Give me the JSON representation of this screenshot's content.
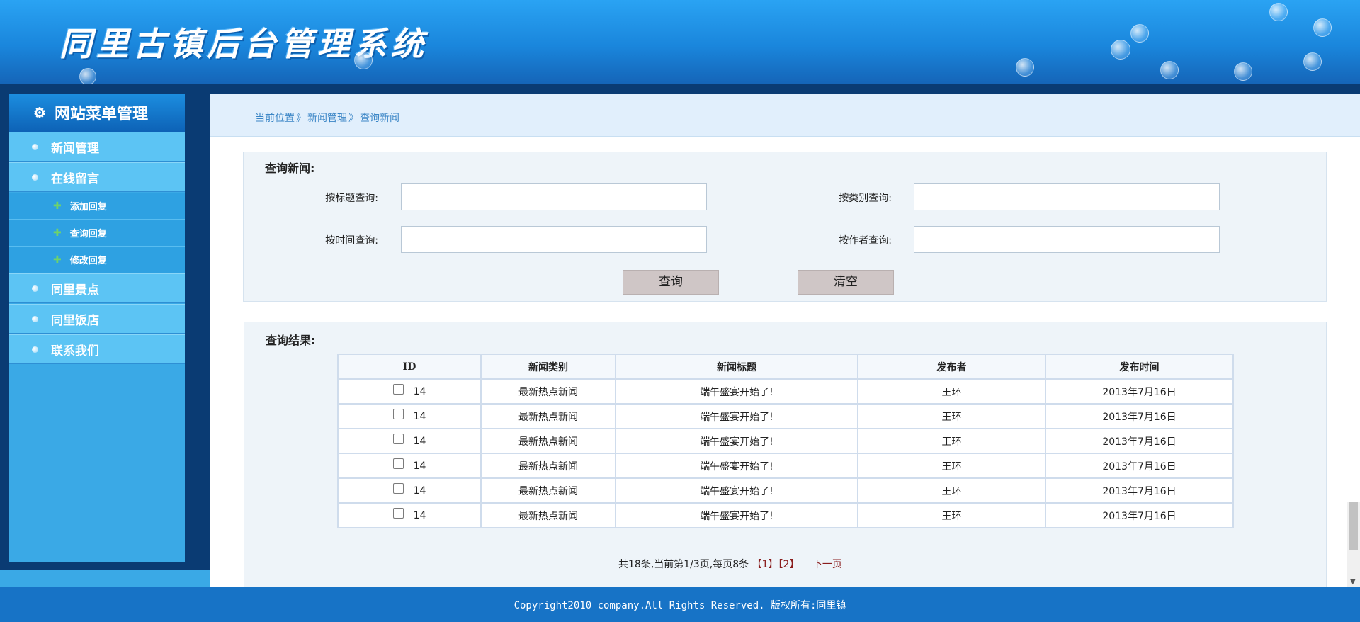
{
  "header": {
    "logo_text": "同里古镇后台管理系统"
  },
  "sidebar": {
    "title": "网站菜单管理",
    "items": [
      {
        "label": "新闻管理"
      },
      {
        "label": "在线留言"
      },
      {
        "label": "同里景点"
      },
      {
        "label": "同里饭店"
      },
      {
        "label": "联系我们"
      }
    ],
    "sub_items": [
      {
        "label": "添加回复"
      },
      {
        "label": "查询回复"
      },
      {
        "label": "修改回复"
      }
    ]
  },
  "breadcrumb": {
    "items": [
      "当前位置",
      "新闻管理",
      "查询新闻"
    ],
    "separator": "》"
  },
  "query": {
    "title": "查询新闻:",
    "fields": {
      "by_title": "按标题查询:",
      "by_category": "按类别查询:",
      "by_time": "按时间查询:",
      "by_author": "按作者查询:"
    },
    "search_button": "查询",
    "clear_button": "清空"
  },
  "results": {
    "title": "查询结果:",
    "columns": [
      "ID",
      "新闻类别",
      "新闻标题",
      "发布者",
      "发布时间"
    ],
    "rows": [
      {
        "id": "14",
        "category": "最新热点新闻",
        "title": "端午盛宴开始了!",
        "author": "王环",
        "date": "2013年7月16日"
      },
      {
        "id": "14",
        "category": "最新热点新闻",
        "title": "端午盛宴开始了!",
        "author": "王环",
        "date": "2013年7月16日"
      },
      {
        "id": "14",
        "category": "最新热点新闻",
        "title": "端午盛宴开始了!",
        "author": "王环",
        "date": "2013年7月16日"
      },
      {
        "id": "14",
        "category": "最新热点新闻",
        "title": "端午盛宴开始了!",
        "author": "王环",
        "date": "2013年7月16日"
      },
      {
        "id": "14",
        "category": "最新热点新闻",
        "title": "端午盛宴开始了!",
        "author": "王环",
        "date": "2013年7月16日"
      },
      {
        "id": "14",
        "category": "最新热点新闻",
        "title": "端午盛宴开始了!",
        "author": "王环",
        "date": "2013年7月16日"
      }
    ],
    "pagination": {
      "summary": "共18条,当前第1/3页,每页8条",
      "page1": "【1】",
      "page2": "【2】",
      "next": "下一页"
    }
  },
  "footer": {
    "text": "Copyright2010 company.All Rights Reserved. 版权所有:同里镇"
  },
  "colors": {
    "header": "#1a86dc",
    "sidebar": "#3aa9e6",
    "footer": "#1773c6",
    "panel": "#eef4f9"
  }
}
